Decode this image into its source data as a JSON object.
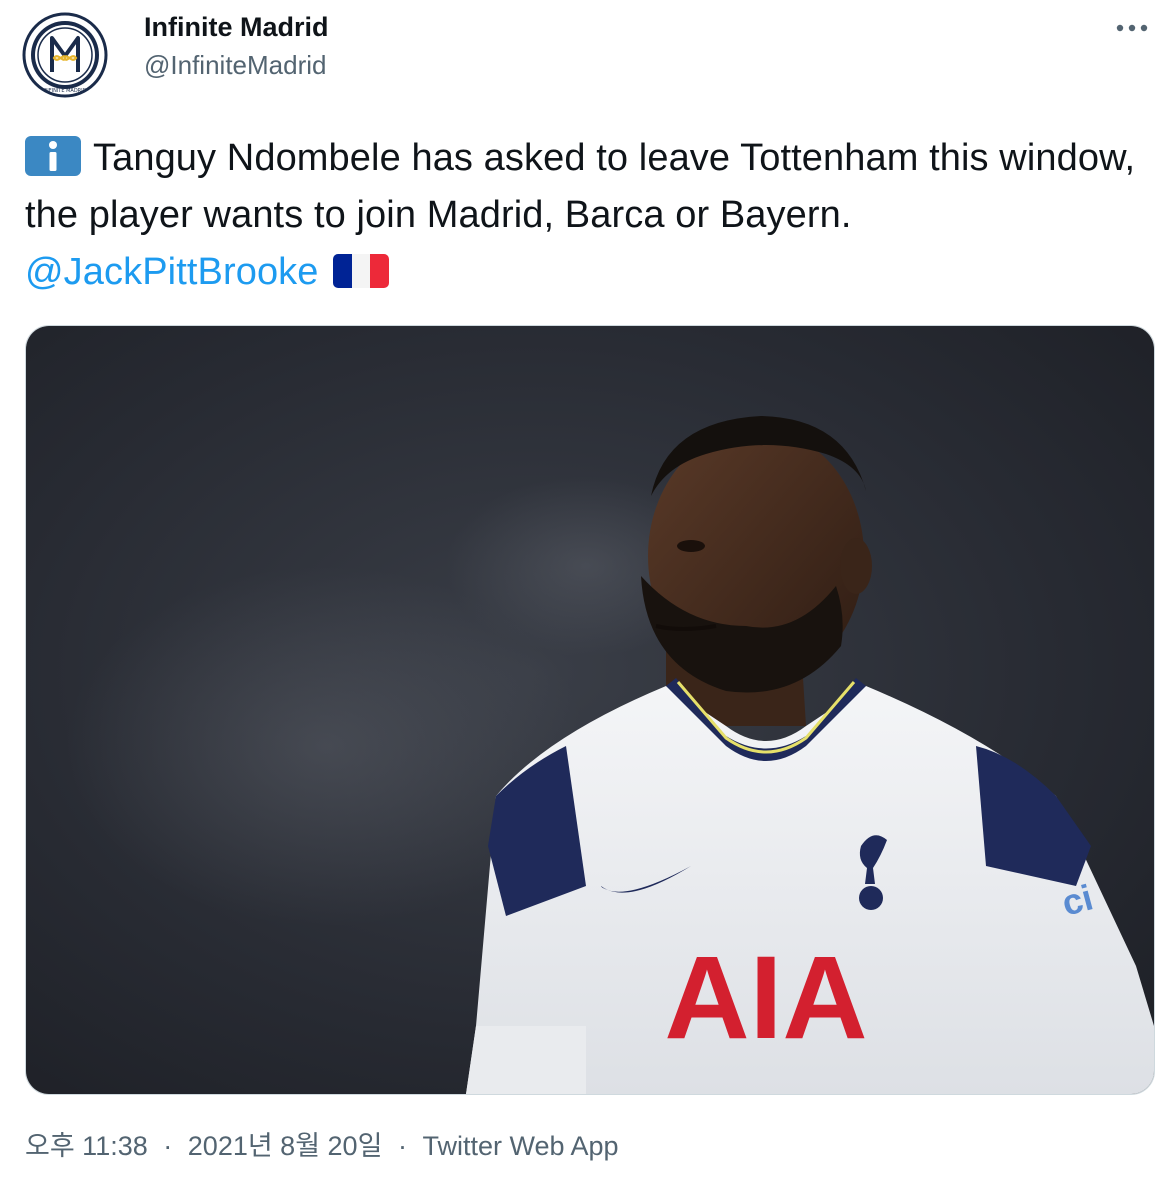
{
  "author": {
    "display_name": "Infinite Madrid",
    "handle": "@InfiniteMadrid",
    "avatar_icon": "infinite-madrid-logo-icon"
  },
  "more_icon": "ellipsis-icon",
  "tweet": {
    "leading_emoji": "information-emoji",
    "text": "Tanguy Ndombele has asked to leave Tottenham this window, the player wants to join Madrid, Barca or Bayern. ",
    "mention": "@JackPittBrooke",
    "trailing_emoji": "france-flag-emoji"
  },
  "media": {
    "sponsor_text": "AIA"
  },
  "meta": {
    "time": "오후 11:38",
    "separator": "·",
    "date": "2021년 8월 20일",
    "source": "Twitter Web App"
  },
  "colors": {
    "link": "#1d9bf0",
    "secondary_text": "#536471",
    "info_emoji_bg": "#3b88c3",
    "flag_blue": "#002395",
    "flag_red": "#ed2939",
    "sponsor_red": "#d3202f"
  }
}
